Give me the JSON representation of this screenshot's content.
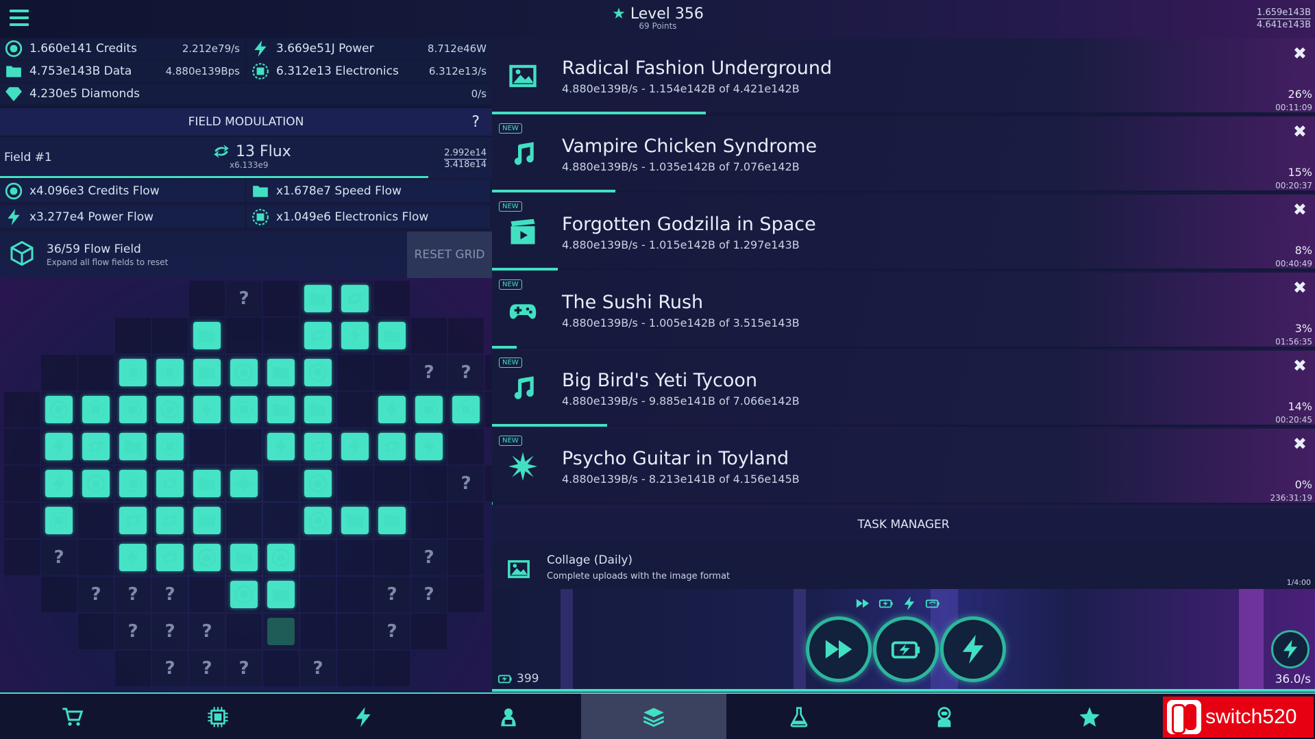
{
  "top": {
    "level": "Level 356",
    "points": "69 Points",
    "right_top": "1.659e143B",
    "right_bottom": "4.641e143B"
  },
  "resources": [
    {
      "icon": "credits-icon",
      "value": "1.660e141 Credits",
      "rate": "2.212e79/s"
    },
    {
      "icon": "power-icon",
      "value": "3.669e51J Power",
      "rate": "8.712e46W"
    },
    {
      "icon": "data-icon",
      "value": "4.753e143B Data",
      "rate": "4.880e139Bps"
    },
    {
      "icon": "electronics-icon",
      "value": "6.312e13 Electronics",
      "rate": "6.312e13/s"
    },
    {
      "icon": "diamond-icon",
      "value": "4.230e5 Diamonds",
      "rate": "0/s"
    }
  ],
  "field_modulation": {
    "header": "FIELD MODULATION",
    "help": "?",
    "field_label": "Field #1",
    "flux": "13 Flux",
    "flux_mult": "x6.133e9",
    "num_top": "2.992e14",
    "num_bottom": "3.418e14",
    "progress": 0.87
  },
  "flows": [
    {
      "icon": "credits-icon",
      "label": "x4.096e3 Credits Flow"
    },
    {
      "icon": "data-icon",
      "label": "x1.678e7 Speed Flow"
    },
    {
      "icon": "power-icon",
      "label": "x3.277e4 Power Flow"
    },
    {
      "icon": "electronics-icon",
      "label": "x1.049e6 Electronics Flow"
    }
  ],
  "flow_field": {
    "title": "36/59 Flow Field",
    "subtitle": "Expand all flow fields to reset",
    "reset": "RESET GRID"
  },
  "uploads": [
    {
      "title": "Radical Fashion Underground",
      "sub": "4.880e139B/s - 1.154e142B of 4.421e142B",
      "pct": "26%",
      "time": "00:11:09",
      "progress": 0.26,
      "icon": "image-icon",
      "new": false
    },
    {
      "title": "Vampire Chicken Syndrome",
      "sub": "4.880e139B/s - 1.035e142B of 7.076e142B",
      "pct": "15%",
      "time": "00:20:37",
      "progress": 0.15,
      "icon": "music-icon",
      "new": true
    },
    {
      "title": "Forgotten Godzilla in Space",
      "sub": "4.880e139B/s - 1.015e142B of 1.297e143B",
      "pct": "8%",
      "time": "00:40:49",
      "progress": 0.08,
      "icon": "video-icon",
      "new": true
    },
    {
      "title": "The Sushi Rush",
      "sub": "4.880e139B/s - 1.005e142B of 3.515e143B",
      "pct": "3%",
      "time": "01:56:35",
      "progress": 0.03,
      "icon": "gamepad-icon",
      "new": true
    },
    {
      "title": "Big Bird's Yeti Tycoon",
      "sub": "4.880e139B/s - 9.885e141B of 7.066e142B",
      "pct": "14%",
      "time": "00:20:45",
      "progress": 0.14,
      "icon": "music-icon",
      "new": true
    },
    {
      "title": "Psycho Guitar in Toyland",
      "sub": "4.880e139B/s - 8.213e141B of 4.156e145B",
      "pct": "0%",
      "time": "236:31:19",
      "progress": 0.0,
      "icon": "starburst-icon",
      "new": true
    }
  ],
  "new_badge": "NEW",
  "close_glyph": "✖",
  "task_manager": {
    "header": "TASK MANAGER",
    "task_title": "Collage (Daily)",
    "task_sub": "Complete uploads with the image format",
    "task_count": "1/4:00"
  },
  "boost": {
    "battery": "399",
    "speed": "36.0/s"
  },
  "nav": [
    {
      "name": "shop-icon"
    },
    {
      "name": "chip-icon"
    },
    {
      "name": "power-icon"
    },
    {
      "name": "hacker-icon"
    },
    {
      "name": "layers-icon",
      "active": true
    },
    {
      "name": "flask-icon"
    },
    {
      "name": "astronaut-icon"
    },
    {
      "name": "star-icon"
    }
  ],
  "logo": {
    "text": "switch520"
  },
  "grid": [
    ".......q.dc.......",
    "......d..cpd......",
    "....ezdrdr..qq....",
    "..rezrpedd.pez....",
    "..pcde..pcpcp.....",
    "..precdx.r...q....",
    "..e.ccd..rdd......",
    "..q.pcrdr...q.....",
    "...qqq.rd..qq.....",
    "....qqq.g..q......",
    ".....qqq.q........"
  ],
  "colors": {
    "accent": "#42e0c2",
    "tile": "#46e3c7",
    "bg": "#1a1a43"
  }
}
